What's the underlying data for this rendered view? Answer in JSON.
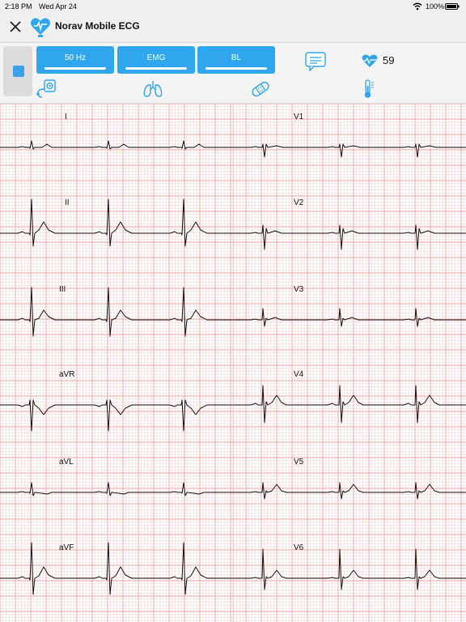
{
  "status_bar": {
    "time": "2:18 PM",
    "date": "Wed Apr 24",
    "battery": "100%"
  },
  "header": {
    "title": "Norav Mobile ECG"
  },
  "filters": [
    {
      "label": "50 Hz"
    },
    {
      "label": "EMG"
    },
    {
      "label": "BL"
    }
  ],
  "heart_rate": "59",
  "icons": {
    "close": "close-icon",
    "logo": "heart-logo-icon",
    "stop": "stop-icon",
    "patient": "patient-monitor-icon",
    "lungs": "lungs-icon",
    "bandage": "bandage-icon",
    "thermometer": "thermometer-icon",
    "message": "message-icon",
    "heart": "heart-rate-icon"
  },
  "colors": {
    "accent": "#2fa6ee",
    "grid": "#e98a8a",
    "trace": "#111111"
  },
  "ecg": {
    "leads_left": [
      "I",
      "II",
      "III",
      "aVR",
      "aVL",
      "aVF"
    ],
    "leads_right": [
      "V1",
      "V2",
      "V3",
      "V4",
      "V5",
      "V6"
    ]
  }
}
